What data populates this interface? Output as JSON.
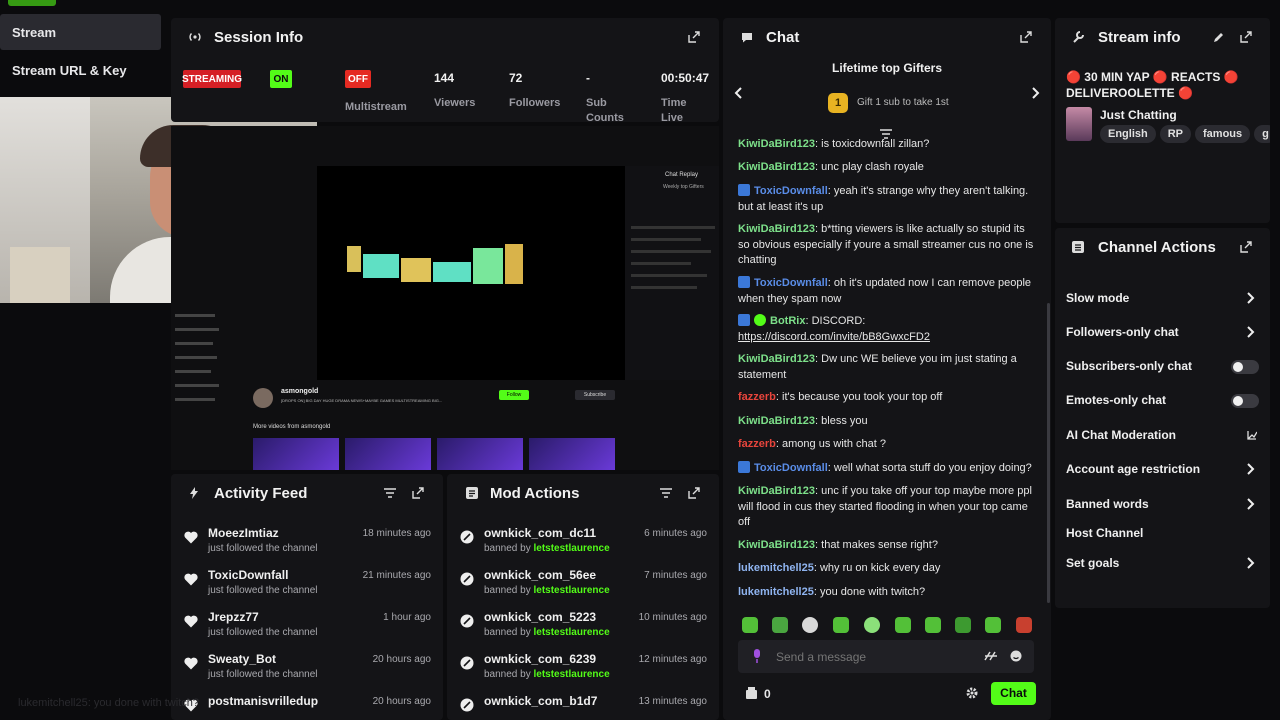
{
  "nav": {
    "items": [
      {
        "label": "Stream"
      },
      {
        "label": "Stream URL & Key"
      }
    ]
  },
  "session": {
    "title": "Session Info",
    "badges": {
      "streaming": "STREAMING",
      "on": "ON",
      "off": "OFF"
    },
    "stats": [
      {
        "value": "",
        "label": "Multistream"
      },
      {
        "value": "144",
        "label": "Viewers"
      },
      {
        "value": "72",
        "label": "Followers"
      },
      {
        "value": "-",
        "label": "Sub Counts"
      },
      {
        "value": "00:50:47",
        "label": "Time Live"
      }
    ]
  },
  "preview": {
    "channel_name": "asmongold",
    "channel_title": "[DROPS ON] BIG DAY HUGE DRAMA NEWS+MAYBE GAMES MULTISTREAMING BIG...",
    "section_label": "More videos from asmongold",
    "follow_label": "Follow",
    "subscribe_label": "Subscribe",
    "side_chat_title": "Chat Replay",
    "side_chat_sub": "Weekly top Gifters"
  },
  "activity": {
    "title": "Activity Feed",
    "items": [
      {
        "name": "MoeezImtiaz",
        "action": "just followed the channel",
        "time": "18 minutes ago"
      },
      {
        "name": "ToxicDownfall",
        "action": "just followed the channel",
        "time": "21 minutes ago"
      },
      {
        "name": "Jrepzz77",
        "action": "just followed the channel",
        "time": "1 hour ago"
      },
      {
        "name": "Sweaty_Bot",
        "action": "just followed the channel",
        "time": "20 hours ago"
      },
      {
        "name": "postmanisvrilledup",
        "action": "",
        "time": "20 hours ago"
      }
    ]
  },
  "modactions": {
    "title": "Mod Actions",
    "banned_by_label": "banned by",
    "items": [
      {
        "name": "ownkick_com_dc11",
        "by": "letstestlaurence",
        "time": "6 minutes ago"
      },
      {
        "name": "ownkick_com_56ee",
        "by": "letstestlaurence",
        "time": "7 minutes ago"
      },
      {
        "name": "ownkick_com_5223",
        "by": "letstestlaurence",
        "time": "10 minutes ago"
      },
      {
        "name": "ownkick_com_6239",
        "by": "letstestlaurence",
        "time": "12 minutes ago"
      },
      {
        "name": "ownkick_com_b1d7",
        "by": "",
        "time": "13 minutes ago"
      }
    ]
  },
  "chat": {
    "title": "Chat",
    "gifters_title": "Lifetime top Gifters",
    "gift_rank": "1",
    "gift_text": "Gift 1 sub to take 1st",
    "messages": [
      {
        "user": "KiwiDaBird123",
        "cls": "u-green",
        "badge": "",
        "text": "is toxicdownfall zillan?"
      },
      {
        "user": "KiwiDaBird123",
        "cls": "u-green",
        "badge": "",
        "text": "unc play clash royale"
      },
      {
        "user": "ToxicDownfall",
        "cls": "u-blue",
        "badge": "blue",
        "text": "yeah it's strange why they aren't talking. but at least it's up"
      },
      {
        "user": "KiwiDaBird123",
        "cls": "u-green",
        "badge": "",
        "text": "b*tting viewers is like actually so stupid its so obvious especially if youre a small streamer cus no one is chatting"
      },
      {
        "user": "ToxicDownfall",
        "cls": "u-blue",
        "badge": "blue",
        "text": "oh it's updated now I can remove people when they spam now"
      },
      {
        "user": "BotRix",
        "cls": "u-green",
        "badge": "bot",
        "text": "DISCORD:"
      },
      {
        "user": "KiwiDaBird123",
        "cls": "u-green",
        "badge": "",
        "text": "Dw unc WE believe you im just stating a statement"
      },
      {
        "user": "fazzerb",
        "cls": "u-red",
        "badge": "",
        "text": "it's because you took your top off"
      },
      {
        "user": "KiwiDaBird123",
        "cls": "u-green",
        "badge": "",
        "text": "bless you"
      },
      {
        "user": "fazzerb",
        "cls": "u-red",
        "badge": "",
        "text": "among us with chat ?"
      },
      {
        "user": "ToxicDownfall",
        "cls": "u-blue",
        "badge": "blue",
        "text": "well what sorta stuff do you enjoy doing?"
      },
      {
        "user": "KiwiDaBird123",
        "cls": "u-green",
        "badge": "",
        "text": "unc if you take off your top maybe more ppl will flood in cus they started flooding in when your top came off"
      },
      {
        "user": "KiwiDaBird123",
        "cls": "u-green",
        "badge": "",
        "text": "that makes sense right?"
      },
      {
        "user": "lukemitchell25",
        "cls": "u-lblue",
        "badge": "",
        "text": "why ru on kick every day"
      },
      {
        "user": "lukemitchell25",
        "cls": "u-lblue",
        "badge": "",
        "text": "you done with twitch?"
      }
    ],
    "discord_link": "https://discord.com/invite/bB8GwxcFD2",
    "input_placeholder": "Send a message",
    "points": "0",
    "send_label": "Chat"
  },
  "streaminfo": {
    "title": "Stream info",
    "stream_title": "🔴 30 MIN YAP 🔴 REACTS 🔴 DELIVEROOLETTE 🔴",
    "category": "Just Chatting",
    "tags": [
      "English",
      "RP",
      "famous",
      "g"
    ]
  },
  "channel_actions": {
    "title": "Channel Actions",
    "items": [
      {
        "label": "Slow mode"
      },
      {
        "label": "Followers-only chat"
      },
      {
        "label": "Subscribers-only chat"
      },
      {
        "label": "Emotes-only chat"
      },
      {
        "label": "AI Chat Moderation"
      },
      {
        "label": "Account age restriction"
      },
      {
        "label": "Banned words"
      },
      {
        "label": "Host Channel"
      },
      {
        "label": "Set goals"
      }
    ]
  },
  "overlay": {
    "bottom_left_chat": "lukemitchell25: you done with twitch?"
  },
  "colors": {
    "accent": "#53fc18",
    "streaming": "#d51f25",
    "panel": "#141417",
    "bg": "#0b0b0d"
  }
}
